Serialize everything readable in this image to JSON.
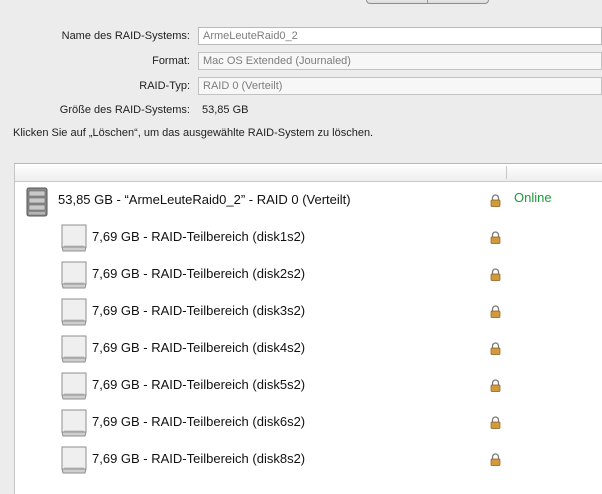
{
  "form": {
    "name_label": "Name des RAID-Systems:",
    "name_value": "ArmeLeuteRaid0_2",
    "format_label": "Format:",
    "format_value": "Mac OS Extended (Journaled)",
    "type_label": "RAID-Typ:",
    "type_value": "RAID 0 (Verteilt)",
    "size_label": "Größe des RAID-Systems:",
    "size_value": "53,85 GB"
  },
  "hint": "Klicken Sie auf „Löschen“, um das ausgewählte RAID-System zu löschen.",
  "raid_set": {
    "label": "53,85 GB - “ArmeLeuteRaid0_2” - RAID 0 (Verteilt)",
    "status": "Online",
    "status_color": "#1f9a3a",
    "icon": "raid-volume-icon"
  },
  "members": [
    {
      "label": "7,69 GB - RAID-Teilbereich (disk1s2)",
      "icon": "disk-icon"
    },
    {
      "label": "7,69 GB - RAID-Teilbereich (disk2s2)",
      "icon": "disk-icon"
    },
    {
      "label": "7,69 GB - RAID-Teilbereich (disk3s2)",
      "icon": "disk-icon"
    },
    {
      "label": "7,69 GB - RAID-Teilbereich (disk4s2)",
      "icon": "disk-icon"
    },
    {
      "label": "7,69 GB - RAID-Teilbereich (disk5s2)",
      "icon": "disk-icon"
    },
    {
      "label": "7,69 GB - RAID-Teilbereich (disk6s2)",
      "icon": "disk-icon"
    },
    {
      "label": "7,69 GB - RAID-Teilbereich (disk8s2)",
      "icon": "disk-icon"
    }
  ]
}
